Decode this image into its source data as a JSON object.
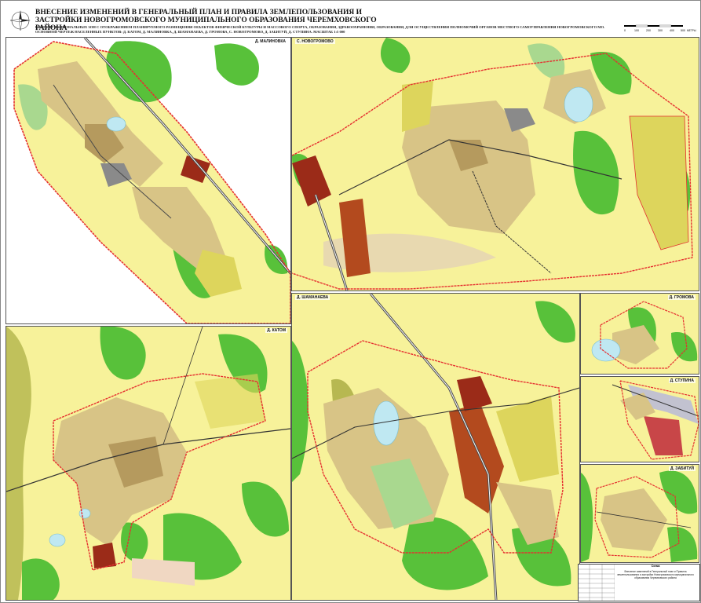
{
  "header": {
    "title": "ВНЕСЕНИЕ ИЗМЕНЕНИЙ В ГЕНЕРАЛЬНЫЙ ПЛАН И ПРАВИЛА ЗЕМЛЕПОЛЬЗОВАНИЯ И ЗАСТРОЙКИ НОВОГРОМОВСКОГО МУНИЦИПАЛЬНОГО ОБРАЗОВАНИЯ ЧЕРЕМХОВСКОГО РАЙОНА",
    "subtitle": "КАРТА ФУНКЦИОНАЛЬНЫХ ЗОН С ОТОБРАЖЕНИЕМ ПЛАНИРУЕМОГО РАЗМЕЩЕНИЯ ОБЪЕКТОВ ФИЗИЧЕСКОЙ КУЛЬТУРЫ И МАССОВОГО СПОРТА, ОБРАЗОВАНИЯ, ЗДРАВООХРАНЕНИЯ, ОБРАЗОВАНИЯ, ДЛЯ ОСУЩЕСТВЛЕНИЯ ПОЛНОМОЧИЙ ОРГАНОВ МЕСТНОГО САМОУПРАВЛЕНИЯ НОВОГРОМОВСКОГО МО. ОСНОВНОЙ ЧЕРТЕЖ НАСЕЛЕННЫХ ПУНКТОВ: Д. КАТОМ, Д. МАЛИНОВКА, Д. ШАМАНАЕВА, Д. ГРОМОВА, С. НОВОГРОМОВО, Д. ЗАБИТУЙ, Д. СТУПИНА. МАСШТАБ 1:5 000"
  },
  "scale": {
    "ticks": [
      "0",
      "100",
      "200",
      "300",
      "400",
      "500"
    ],
    "unit": "МЕТРЫ"
  },
  "panels": {
    "malinovka": "Д. МАЛИНОВКА",
    "novogromovo": "С. НОВОГРОМОВО",
    "katom": "Д. КАТОМ",
    "shamanaeva": "Д. ШАМАНАЕВА",
    "gromova": "Д. ГРОМОВА",
    "stupina": "Д. СТУПИНА",
    "zabituy": "Д. ЗАБИТУЙ"
  },
  "stamp": {
    "head": "Схема",
    "title": "Внесение изменений в Генеральный план и Правила землепользования и застройки Новогромовского муниципального образования Черемховского района"
  },
  "colors": {
    "agri": "#f7f29a",
    "forest": "#58c13a",
    "residential": "#d8c486",
    "residential_dark": "#b59a5e",
    "industrial": "#9b2b18",
    "water": "#bfe8f2",
    "boundary": "#e53030",
    "road": "#4a4a4a",
    "public": "#8a8a8a",
    "green_light": "#a9d88f",
    "yellow_zone": "#ddd55c"
  }
}
